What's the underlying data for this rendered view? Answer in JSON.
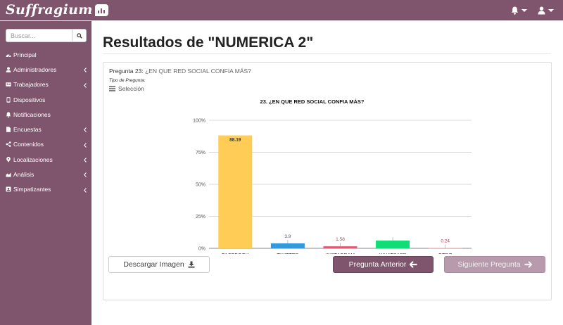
{
  "app": {
    "logo_text": "Suffragium",
    "brand_color": "#7f556e"
  },
  "topbar": {
    "icons": [
      "bell-icon",
      "user-icon"
    ]
  },
  "sidebar": {
    "search": {
      "placeholder": "Buscar..."
    },
    "items": [
      {
        "label": "Principal",
        "icon": "dashboard-icon",
        "has_submenu": false
      },
      {
        "label": "Administradores",
        "icon": "user-icon",
        "has_submenu": true
      },
      {
        "label": "Trabajadores",
        "icon": "id-card-icon",
        "has_submenu": true
      },
      {
        "label": "Dispositivos",
        "icon": "tablet-icon",
        "has_submenu": false
      },
      {
        "label": "Notificaciones",
        "icon": "bell-icon",
        "has_submenu": false
      },
      {
        "label": "Encuestas",
        "icon": "file-icon",
        "has_submenu": true
      },
      {
        "label": "Contenidos",
        "icon": "share-icon",
        "has_submenu": true
      },
      {
        "label": "Localizaciones",
        "icon": "map-marker-icon",
        "has_submenu": true
      },
      {
        "label": "Análisis",
        "icon": "area-chart-icon",
        "has_submenu": true
      },
      {
        "label": "Simpatizantes",
        "icon": "portrait-icon",
        "has_submenu": true
      }
    ]
  },
  "main": {
    "page_title": "Resultados de \"NUMERICA 2\"",
    "question": {
      "number_label": "Pregunta 23:",
      "text": "¿EN QUE RED SOCIAL CONFIA MÁS?",
      "tipo_label": "Tipo de Pregunta:",
      "tipo_value": "Selección"
    },
    "buttons": {
      "download": "Descargar Imagen",
      "prev": "Pregunta Anterior",
      "next": "Siguiente Pregunta"
    }
  },
  "chart_data": {
    "type": "bar",
    "title": "23. ¿EN QUE RED SOCIAL CONFIA MÁS?",
    "categories": [
      "FACEBOOK",
      "TWITTER",
      "INSTAGRAM",
      "WHATSAPP",
      "OTRO"
    ],
    "values": [
      88.19,
      3.9,
      1.58,
      6.09,
      0.24
    ],
    "value_labels": [
      "88.19",
      "3.9",
      "1.58",
      "6.09",
      "0.24"
    ],
    "colors": [
      "#ffcc55",
      "#3399dd",
      "#e05a74",
      "#11dd77",
      "#f3a3a3"
    ],
    "label_colors": [
      "#333333",
      "#555555",
      "#c0394b",
      "#ffffff",
      "#c0394b"
    ],
    "yticks": [
      "0%",
      "25%",
      "50%",
      "75%",
      "100%"
    ],
    "ylim": [
      0,
      100
    ],
    "grid": true,
    "legend": "none"
  }
}
